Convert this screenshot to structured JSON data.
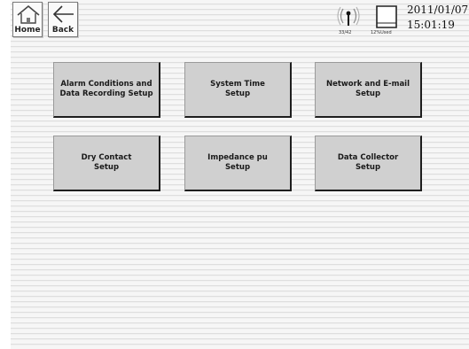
{
  "topbar": {
    "home_label": "Home",
    "back_label": "Back",
    "signal_text": "33/42",
    "storage_text": "12%Used",
    "date": "2011/01/07",
    "time": "15:01:19"
  },
  "tiles": [
    {
      "label": "Alarm Conditions and\nData Recording Setup"
    },
    {
      "label": "System Time\nSetup"
    },
    {
      "label": "Network and E-mail\nSetup"
    },
    {
      "label": "Dry Contact\nSetup"
    },
    {
      "label": "Impedance pu\nSetup"
    },
    {
      "label": "Data Collector\nSetup"
    }
  ],
  "icons": {
    "home": "home-icon",
    "back": "back-arrow-icon",
    "signal": "antenna-signal-icon",
    "storage": "storage-card-icon"
  }
}
